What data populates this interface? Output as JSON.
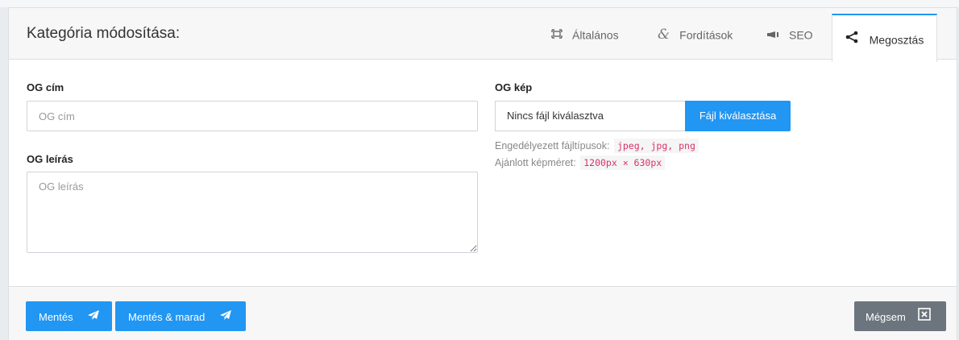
{
  "header": {
    "title": "Kategória módosítása:",
    "tabs": [
      {
        "label": "Általános",
        "icon": "expand-icon"
      },
      {
        "label": "Fordítások",
        "icon": "ampersand-icon"
      },
      {
        "label": "SEO",
        "icon": "megaphone-icon"
      },
      {
        "label": "Megosztás",
        "icon": "share-icon",
        "active": true
      }
    ]
  },
  "form": {
    "og_title": {
      "label": "OG cím",
      "placeholder": "OG cím"
    },
    "og_description": {
      "label": "OG leírás",
      "placeholder": "OG leírás"
    },
    "og_image": {
      "label": "OG kép",
      "file_status": "Nincs fájl kiválasztva",
      "button_label": "Fájl kiválasztása",
      "allowed_label": "Engedélyezett fájltípusok:",
      "allowed_types": "jpeg, jpg, png",
      "recommended_label": "Ajánlott képméret:",
      "recommended_size": "1200px × 630px"
    }
  },
  "footer": {
    "save_label": "Mentés",
    "save_stay_label": "Mentés & marad",
    "cancel_label": "Mégsem"
  },
  "colors": {
    "primary": "#2196f3",
    "secondary": "#6c757d",
    "code_text": "#d6336c"
  }
}
